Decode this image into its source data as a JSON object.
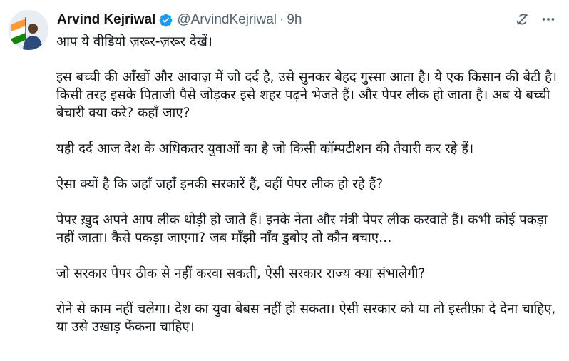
{
  "author": {
    "display_name": "Arvind Kejriwal",
    "handle": "@ArvindKejriwal",
    "separator": "·",
    "time": "9h"
  },
  "icons": {
    "avatar": "avatar",
    "verified": "verified-badge-icon",
    "grok": "grok-icon",
    "more": "more-options-icon"
  },
  "colors": {
    "verified": "#1d9bf0",
    "text": "#0f1419",
    "secondary": "#536471"
  },
  "paragraphs": [
    "आप ये वीडियो ज़रूर-ज़रूर देखें।",
    "इस बच्ची की आँखों और आवाज़ में जो दर्द है, उसे सुनकर बेहद गुस्सा आता है। ये एक किसान की बेटी है। किसी तरह इसके पिताजी पैसे जोड़कर इसे शहर पढ़ने भेजते हैं। और पेपर लीक हो जाता है। अब ये बच्ची बेचारी क्या करे? कहाँ जाए?",
    "यही दर्द आज देश के अधिकतर युवाओं का है जो किसी कॉम्पटीशन की तैयारी कर रहे हैं।",
    "ऐसा क्यों है कि जहाँ जहाँ इनकी सरकारें हैं, वहीं पेपर लीक हो रहे हैं?",
    "पेपर ख़ुद अपने आप लीक थोड़ी हो जाते हैं। इनके नेता और मंत्री पेपर लीक करवाते हैं। कभी कोई पकड़ा नहीं जाता। कैसे पकड़ा जाएगा? जब माँझी नाँव डुबोए तो कौन बचाए…",
    "जो सरकार पेपर ठीक से नहीं करवा सकती, ऐसी सरकार राज्य क्या संभालेगी?",
    "रोने से काम नहीं चलेगा। देश का युवा बेबस नहीं हो सकता। ऐसी सरकार को या तो इस्तीफ़ा दे देना चाहिए, या उसे उखाड़ फेंकना चाहिए।"
  ]
}
